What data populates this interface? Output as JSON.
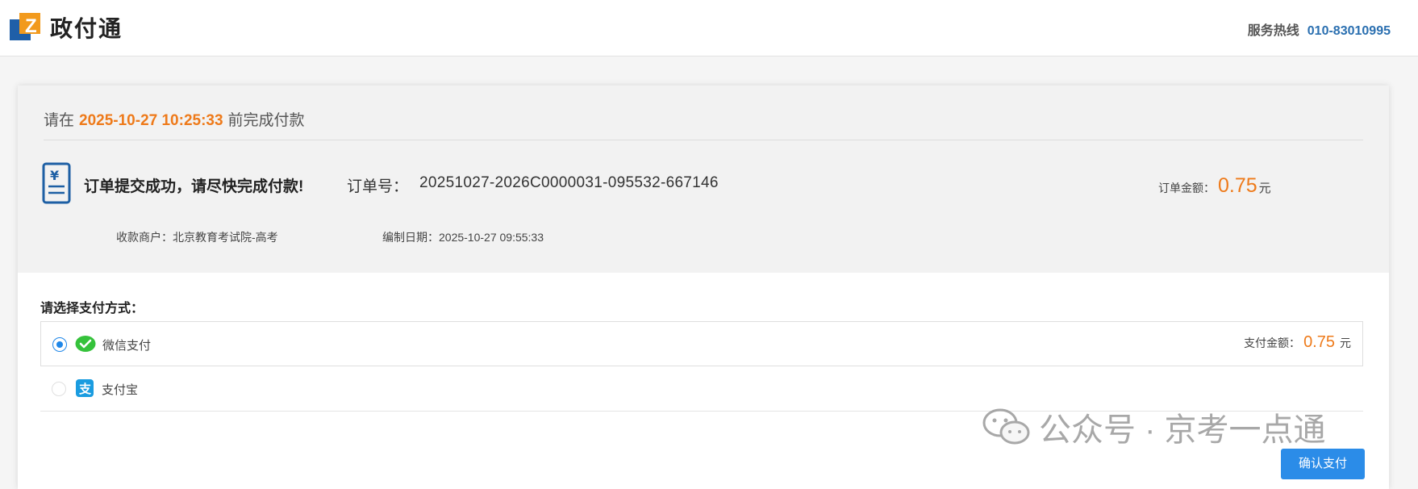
{
  "header": {
    "brand": "政付通",
    "hotline_label": "服务热线",
    "hotline_number": "010-83010995"
  },
  "deadline": {
    "prefix": "请在",
    "time": "2025-10-27 10:25:33",
    "suffix": "前完成付款"
  },
  "order": {
    "success_msg": "订单提交成功，请尽快完成付款!",
    "number_label": "订单号：",
    "number": "20251027-2026C0000031-095532-667146",
    "amount_label": "订单金额：",
    "amount": "0.75",
    "amount_unit": "元",
    "merchant_label": "收款商户：",
    "merchant": "北京教育考试院-高考",
    "created_label": "编制日期：",
    "created": "2025-10-27 09:55:33"
  },
  "payment": {
    "title": "请选择支付方式：",
    "methods": [
      {
        "name": "微信支付",
        "icon": "wechat-pay-icon",
        "selected": true,
        "amount_label": "支付金额：",
        "amount": "0.75",
        "unit": "元"
      },
      {
        "name": "支付宝",
        "icon": "alipay-icon",
        "selected": false
      }
    ],
    "confirm_label": "确认支付"
  },
  "watermark": "公众号 · 京考一点通",
  "colors": {
    "accent_orange": "#ee7a1a",
    "primary_blue": "#2b8ce8",
    "hotline_blue": "#2a6fb0",
    "wechat_green": "#35c23b",
    "alipay_blue": "#1a9ce0"
  }
}
